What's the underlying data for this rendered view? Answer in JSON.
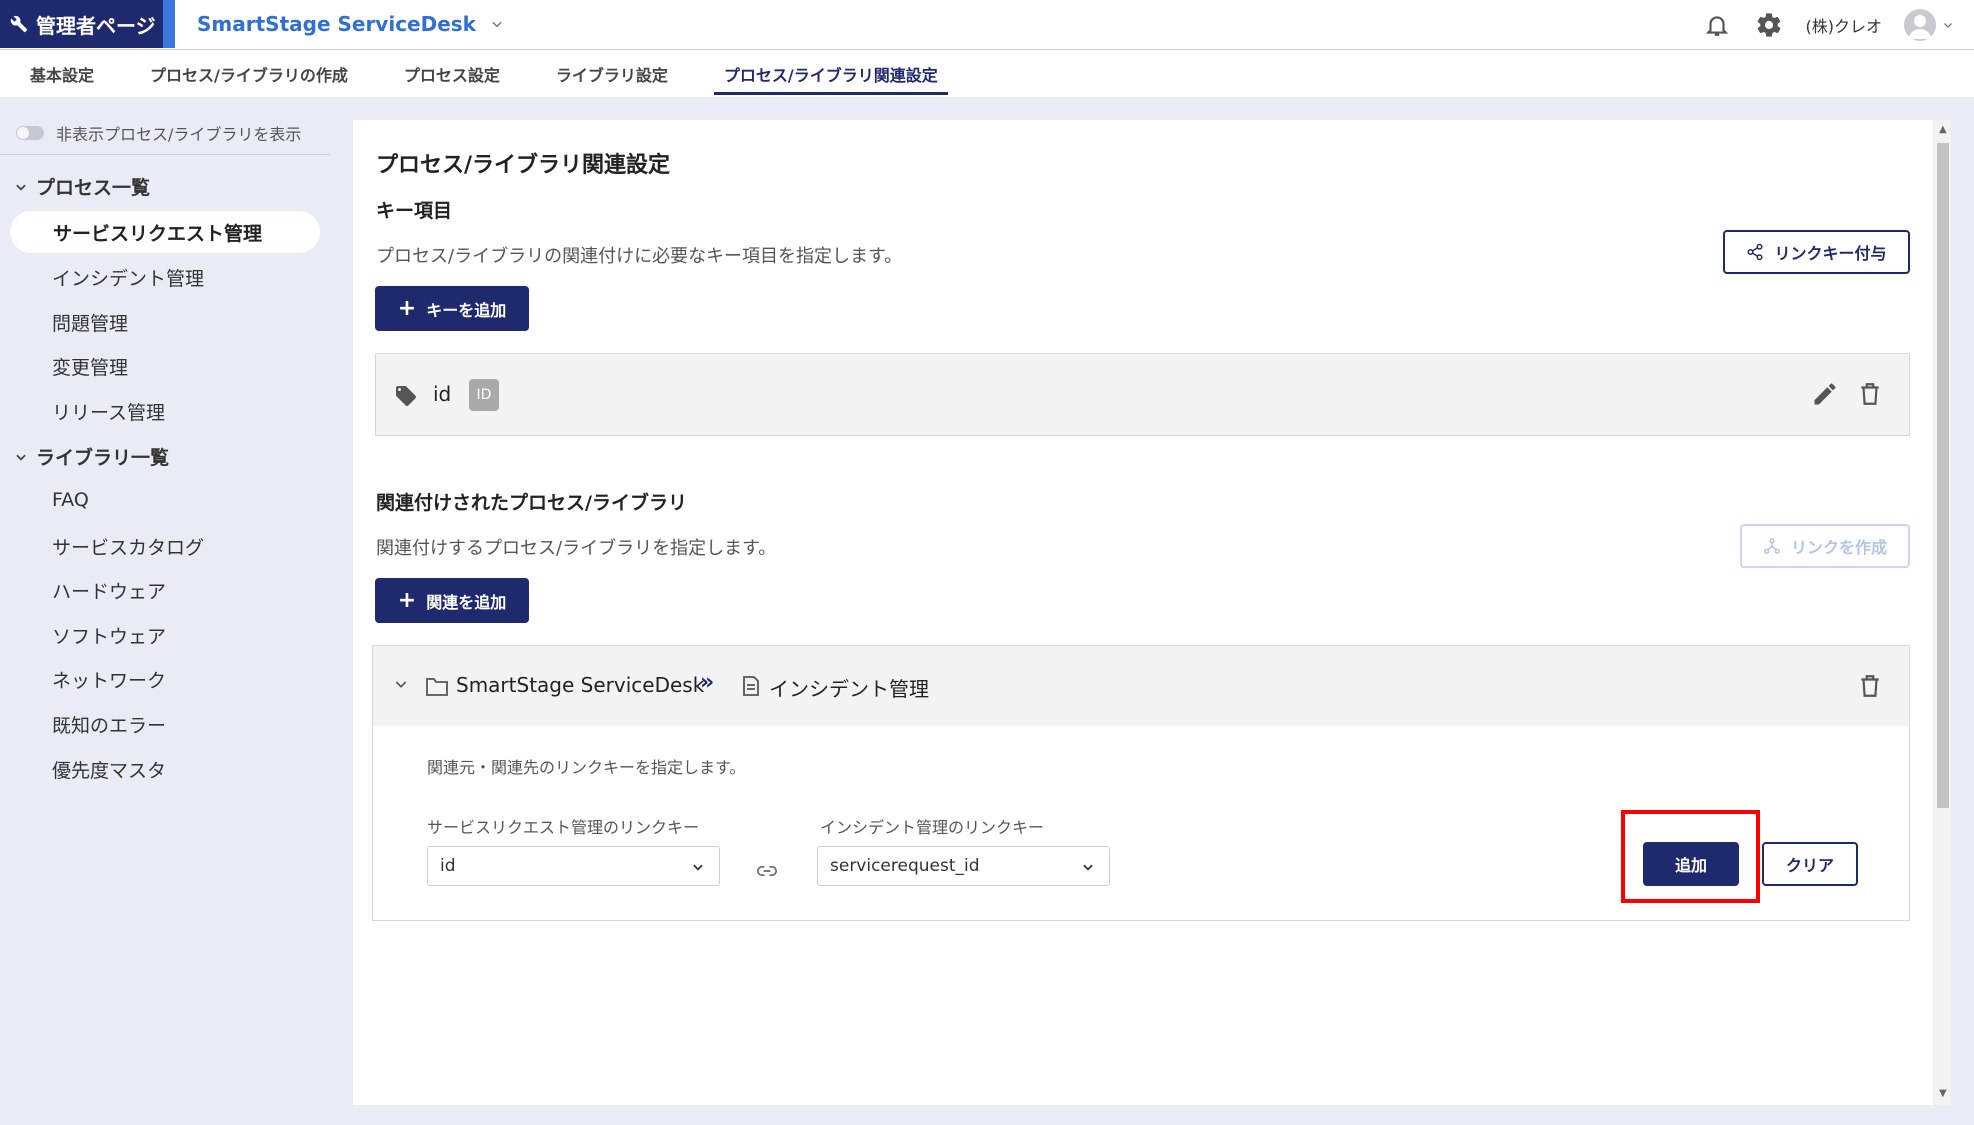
{
  "header": {
    "admin_label": "管理者ページ",
    "app_name": "SmartStage ServiceDesk",
    "user_name": "(株)クレオ"
  },
  "tabs": [
    {
      "label": "基本設定"
    },
    {
      "label": "プロセス/ライブラリの作成"
    },
    {
      "label": "プロセス設定"
    },
    {
      "label": "ライブラリ設定"
    },
    {
      "label": "プロセス/ライブラリ関連設定",
      "active": true
    }
  ],
  "sidebar": {
    "toggle_label": "非表示プロセス/ライブラリを表示",
    "process_group": "プロセス一覧",
    "processes": [
      "サービスリクエスト管理",
      "インシデント管理",
      "問題管理",
      "変更管理",
      "リリース管理"
    ],
    "library_group": "ライブラリ一覧",
    "libraries": [
      "FAQ",
      "サービスカタログ",
      "ハードウェア",
      "ソフトウェア",
      "ネットワーク",
      "既知のエラー",
      "優先度マスタ"
    ]
  },
  "main": {
    "title": "プロセス/ライブラリ関連設定",
    "key_section": {
      "heading": "キー項目",
      "description": "プロセス/ライブラリの関連付けに必要なキー項目を指定します。",
      "link_key_button": "リンクキー付与",
      "add_key_button": "キーを追加",
      "keys": [
        {
          "name": "id",
          "badge": "ID"
        }
      ]
    },
    "relation_section": {
      "heading": "関連付けされたプロセス/ライブラリ",
      "description": "関連付けするプロセス/ライブラリを指定します。",
      "create_link_button": "リンクを作成",
      "add_relation_button": "関連を追加",
      "relation": {
        "source": "SmartStage ServiceDesk",
        "arrows": "»",
        "target": "インシデント管理",
        "description": "関連元・関連先のリンクキーを指定します。",
        "source_key_label": "サービスリクエスト管理のリンクキー",
        "source_key_value": "id",
        "target_key_label": "インシデント管理のリンクキー",
        "target_key_value": "servicerequest_id",
        "add_button": "追加",
        "clear_button": "クリア"
      }
    }
  },
  "colors": {
    "primary": "#1f2a6e",
    "accent": "#3a78e0",
    "highlight": "#ff0000"
  }
}
